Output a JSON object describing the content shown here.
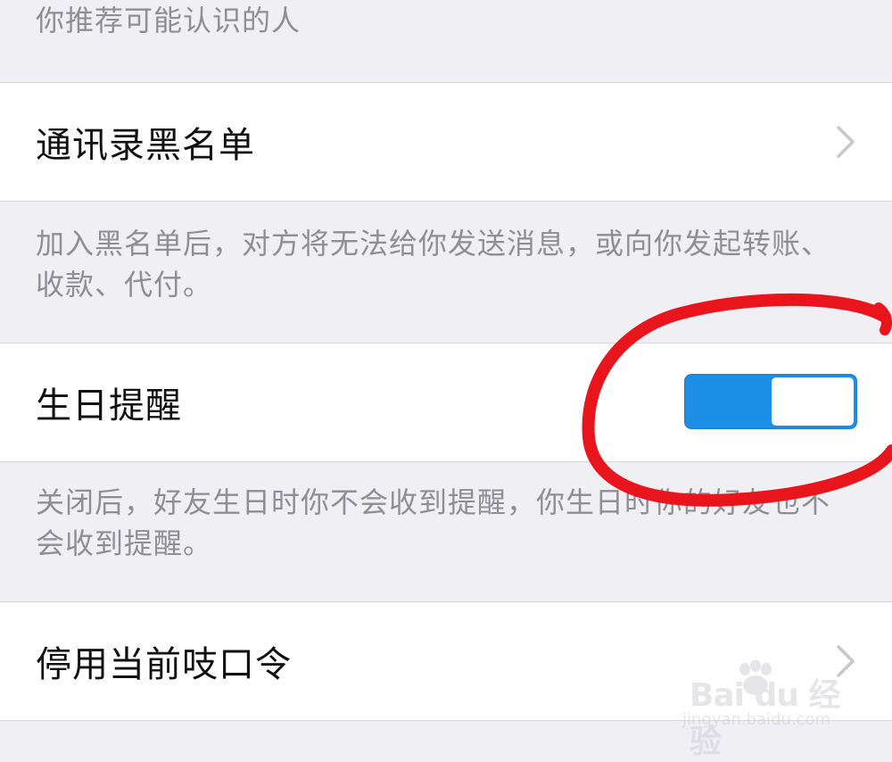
{
  "sections": {
    "top_note": "你推荐可能认识的人",
    "blacklist": {
      "label": "通讯录黑名单",
      "note": "加入黑名单后，对方将无法给你发送消息，或向你发起转账、收款、代付。"
    },
    "birthday": {
      "label": "生日提醒",
      "toggle_on": true,
      "note": "关闭后，好友生日时你不会收到提醒，你生日时你的好友也不会收到提醒。"
    },
    "password": {
      "label": "停用当前吱口令"
    }
  },
  "icons": {
    "chevron": "chevron-right-icon",
    "annotation": "red-circle-annotation",
    "watermark_logo": "baidu-paw-logo"
  },
  "colors": {
    "background": "#efeff4",
    "toggle_on": "#1e8fe6",
    "annotation": "#e8161c",
    "chevron": "#c7c7cc"
  },
  "watermark": {
    "logo": "Bai du 经验",
    "url": "jingyan.baidu.com"
  }
}
